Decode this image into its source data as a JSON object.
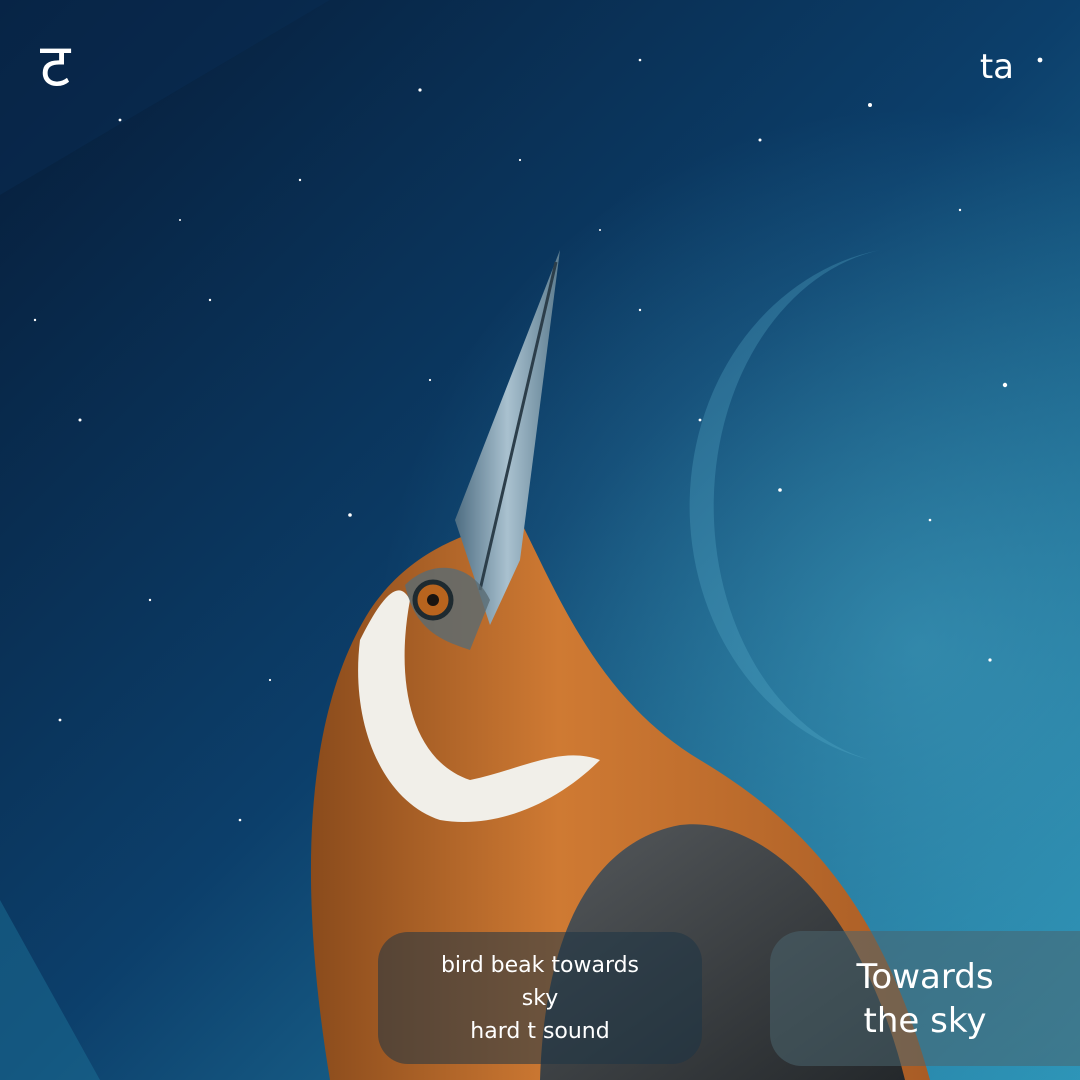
{
  "letter": {
    "glyph": "ट",
    "transliteration": "ta"
  },
  "hint": {
    "lines": [
      "bird beak towards",
      "sky",
      "hard t sound"
    ]
  },
  "meaning": {
    "lines": [
      "Towards",
      "the sky"
    ]
  },
  "colors": {
    "sky_dark": "#07203f",
    "sky_mid": "#0f4a78",
    "sky_light": "#2a8bb0",
    "bird_orange": "#c8702a",
    "bird_white": "#f1efe9",
    "beak": "#8ea8b8",
    "wing": "#3f4448"
  }
}
